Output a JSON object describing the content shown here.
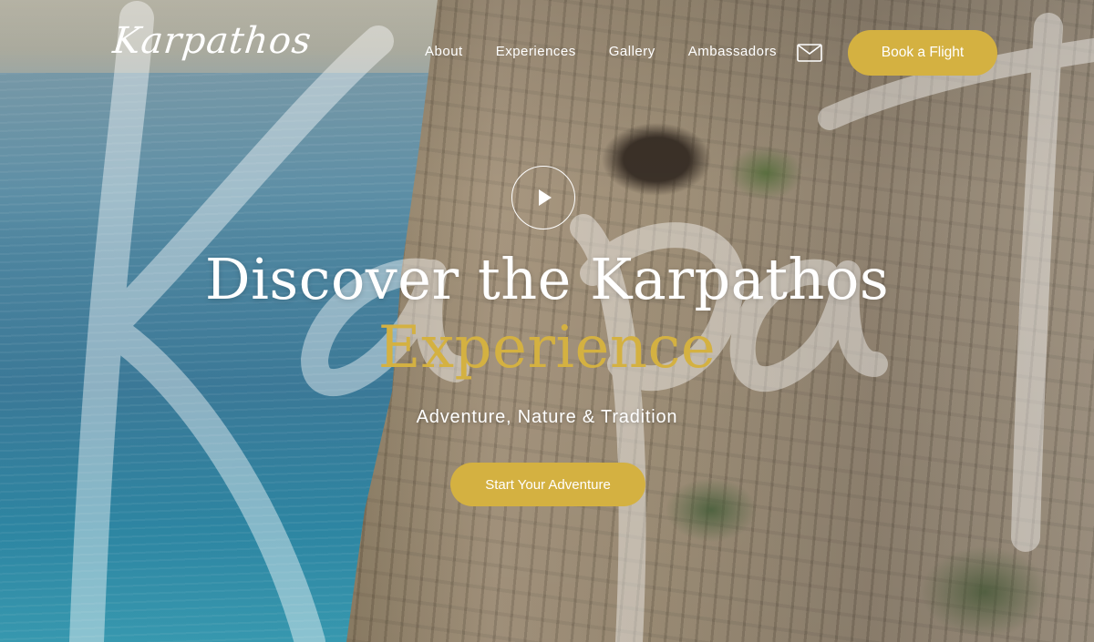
{
  "brand": {
    "logo_text": "Karpathos",
    "accent_color": "#d4b141"
  },
  "nav": {
    "links": [
      "About",
      "Experiences",
      "Gallery",
      "Ambassadors"
    ],
    "mail_icon": "mail-icon",
    "book_label": "Book a Flight"
  },
  "hero": {
    "play_icon": "play-icon",
    "headline_line1": "Discover the Karpathos",
    "headline_line2": "Experience",
    "tagline": "Adventure, Nature & Tradition",
    "cta_label": "Start Your Adventure"
  }
}
